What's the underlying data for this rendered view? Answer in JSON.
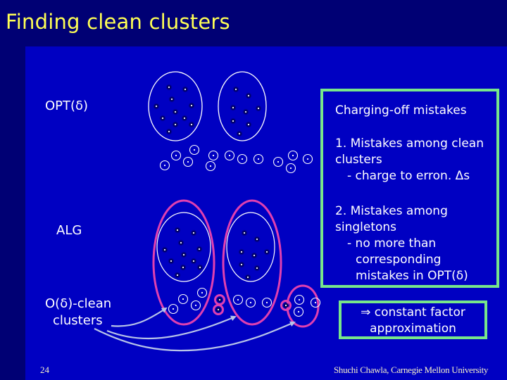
{
  "slide": {
    "title": "Finding clean clusters",
    "page_number": "24",
    "credit": "Shuchi Chawla, Carnegie Mellon University"
  },
  "labels": {
    "opt": "OPT(δ)",
    "alg": "ALG",
    "clean_line1": "O(δ)-clean",
    "clean_line2": "clusters"
  },
  "charging_box": {
    "heading": "Charging-off mistakes",
    "item1_line1": "1. Mistakes among clean",
    "item1_line2": "clusters",
    "item1_line3": "- charge to erron. Δs",
    "item2_line1": "2. Mistakes among",
    "item2_line2": "singletons",
    "item2_line3": "- no more than",
    "item2_line4": "corresponding",
    "item2_line5": "mistakes in OPT(δ)"
  },
  "conclusion_box": {
    "line1": "⇒ constant factor",
    "line2": "approximation"
  },
  "colors": {
    "title": "#FFFF55",
    "background": "#000074",
    "slide_area": "#0000C2",
    "box_border": "#77E68A",
    "alg_cluster": "#E040B0",
    "opt_cluster": "#FFFFFF",
    "arrow": "#B8C4E8"
  }
}
